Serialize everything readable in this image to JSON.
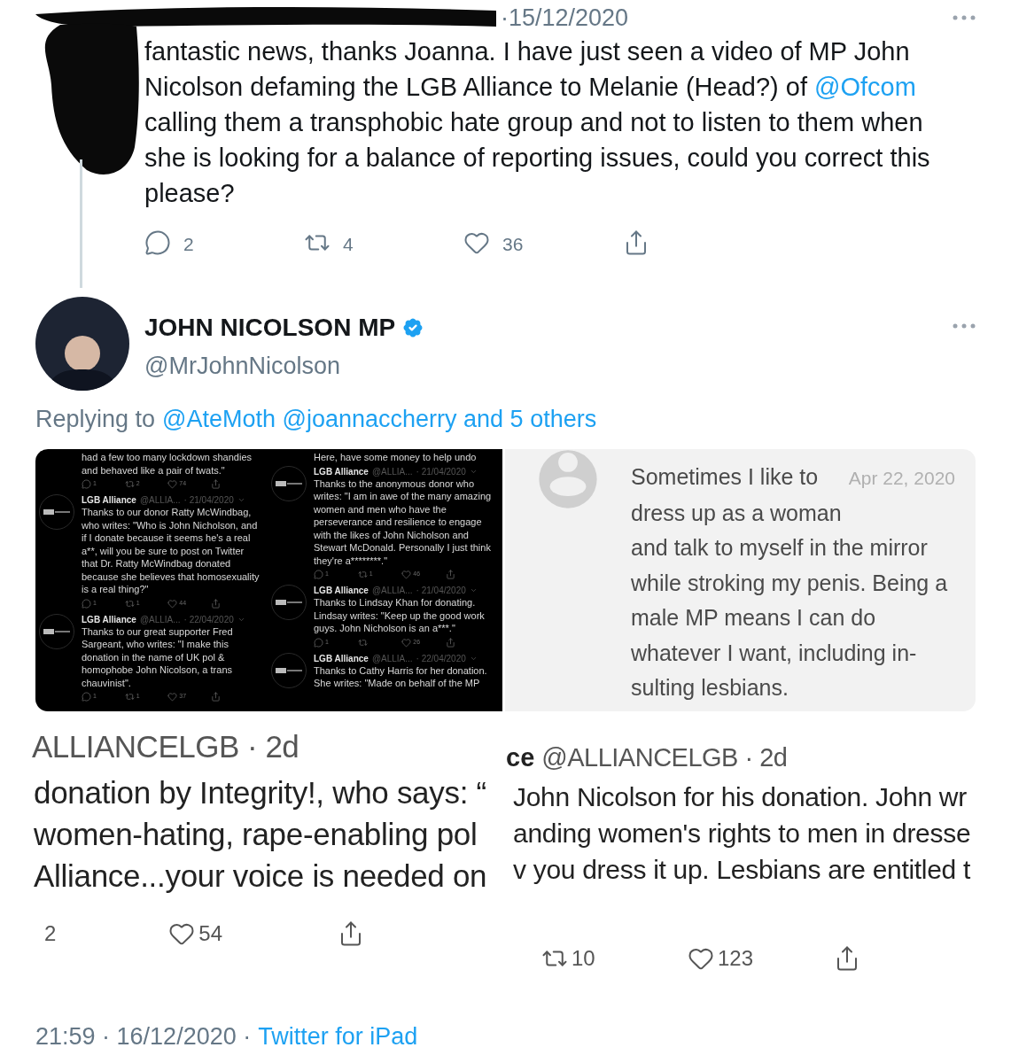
{
  "tweet": {
    "date": "·15/12/2020",
    "parts": [
      {
        "kind": "text",
        "text": "fantastic news, thanks Joanna. I have just seen a video of MP John Nicolson defaming the LGB Alliance to Melanie (Head?) of "
      },
      {
        "kind": "mention",
        "text": "@Ofcom"
      },
      {
        "kind": "text",
        "text": " calling them a transphobic hate group and not to listen to them when she is looking for a balance of reporting issues, could you correct this please?"
      }
    ],
    "actions": [
      {
        "kind": "reply",
        "count": "2"
      },
      {
        "kind": "retweet",
        "count": "4"
      },
      {
        "kind": "like",
        "count": "36"
      },
      {
        "kind": "share"
      }
    ]
  },
  "reply": {
    "name": "JOHN NICOLSON MP",
    "verified": true,
    "handle": "@MrJohnNicolson",
    "replying_label": "Replying to",
    "replying_to": "@AteMoth @joannaccherry and 5 others"
  },
  "images": [
    {
      "kind": "dark_thread",
      "columns": [
        {
          "items": [
            {
              "kind": "fragment",
              "text": "had a few too many lockdown shandies and behaved like a pair of twats.\"",
              "actions": [
                {
                  "kind": "reply",
                  "count": "1"
                },
                {
                  "kind": "retweet",
                  "count": "2"
                },
                {
                  "kind": "like",
                  "count": "74"
                },
                {
                  "kind": "share"
                }
              ]
            },
            {
              "kind": "tweet",
              "name": "LGB Alliance",
              "handle": "@ALLIA...",
              "date": "· 21/04/2020",
              "text": "Thanks to our donor Ratty McWindbag, who writes: \"Who is John Nicholson, and if I donate because it seems he's a real a**, will you be sure to post on Twitter that Dr. Ratty McWindbag donated because she believes that homosexuality is a real thing?\"",
              "actions": [
                {
                  "kind": "reply",
                  "count": "1"
                },
                {
                  "kind": "retweet",
                  "count": "1"
                },
                {
                  "kind": "like",
                  "count": "44"
                },
                {
                  "kind": "share"
                }
              ]
            },
            {
              "kind": "tweet",
              "name": "LGB Alliance",
              "handle": "@ALLIA...",
              "date": "· 22/04/2020",
              "text": "Thanks to our great supporter Fred Sargeant, who writes: \"I make this donation in the name of UK pol & homophobe John Nicolson, a trans chauvinist\".",
              "actions": [
                {
                  "kind": "reply",
                  "count": "1"
                },
                {
                  "kind": "retweet",
                  "count": "1"
                },
                {
                  "kind": "like",
                  "count": "37"
                },
                {
                  "kind": "share"
                }
              ]
            }
          ]
        },
        {
          "items": [
            {
              "kind": "fragment",
              "text": "Here, have some money to help undo"
            },
            {
              "kind": "tweet",
              "name": "LGB Alliance",
              "handle": "@ALLIA...",
              "date": "· 21/04/2020",
              "text": "Thanks to the anonymous donor who writes: \"I am in awe of the many amazing women and men who have the perseverance and resilience to engage with the likes of John Nicholson and Stewart McDonald. Personally I just think they're a********.\"",
              "actions": [
                {
                  "kind": "reply",
                  "count": "1"
                },
                {
                  "kind": "retweet",
                  "count": "1"
                },
                {
                  "kind": "like",
                  "count": "46"
                },
                {
                  "kind": "share"
                }
              ]
            },
            {
              "kind": "tweet",
              "name": "LGB Alliance",
              "handle": "@ALLIA...",
              "date": "· 21/04/2020",
              "text": "Thanks to Lindsay Khan for donating. Lindsay writes: \"Keep up the good work guys. John Nicholson is an a***.\"",
              "actions": [
                {
                  "kind": "reply",
                  "count": "1"
                },
                {
                  "kind": "retweet"
                },
                {
                  "kind": "like",
                  "count": "26"
                },
                {
                  "kind": "share"
                }
              ]
            },
            {
              "kind": "tweet",
              "name": "LGB Alliance",
              "handle": "@ALLIA...",
              "date": "· 22/04/2020",
              "text": "Thanks to Cathy Harris for her donation. She writes: \"Made on behalf of the MP"
            }
          ]
        }
      ]
    },
    {
      "kind": "note",
      "date": "Apr 22, 2020",
      "lines": [
        "Sometimes I like to",
        "dress up as a woman",
        "and talk to myself in the mirror",
        "while stroking my penis. Being a",
        "male MP means I can do",
        "whatever I want, including in-",
        "sulting lesbians."
      ]
    }
  ],
  "collage": [
    {
      "handle": "ALLIANCELGB · 2d",
      "lines": [
        "donation by Integrity!, who says: “",
        "women-hating, rape-enabling pol",
        "Alliance...your voice is needed on"
      ],
      "actions": [
        {
          "kind": "retweet",
          "count": "2"
        },
        {
          "kind": "like",
          "count": "54"
        },
        {
          "kind": "share"
        }
      ]
    },
    {
      "name": "ce",
      "handle": "@ALLIANCELGB · 2d",
      "lines": [
        "John Nicolson for his donation. John wr",
        "anding women's rights to men in dresse",
        "v you dress it up. Lesbians are entitled t"
      ],
      "actions": [
        {
          "kind": "retweet",
          "count": "10"
        },
        {
          "kind": "like",
          "count": "123"
        },
        {
          "kind": "share"
        }
      ]
    }
  ],
  "footer": {
    "meta": "21:59 · 16/12/2020 ·",
    "source": "Twitter for iPad"
  }
}
